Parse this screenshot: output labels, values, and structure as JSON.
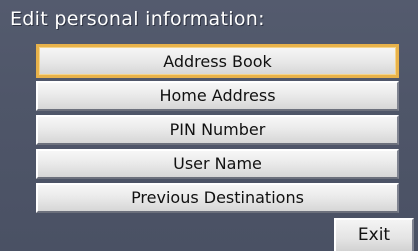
{
  "header": {
    "title": "Edit personal information:"
  },
  "menu": {
    "items": [
      {
        "label": "Address Book",
        "selected": true
      },
      {
        "label": "Home Address",
        "selected": false
      },
      {
        "label": "PIN Number",
        "selected": false
      },
      {
        "label": "User Name",
        "selected": false
      },
      {
        "label": "Previous Destinations",
        "selected": false
      }
    ]
  },
  "footer": {
    "exit_label": "Exit"
  },
  "colors": {
    "background": "#4f5669",
    "button_face": "#e9e9e9",
    "selection_outline": "#e8b24a",
    "header_text": "#ffffff"
  }
}
